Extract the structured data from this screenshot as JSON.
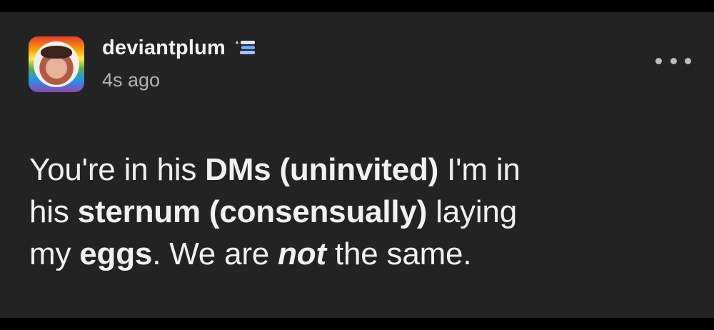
{
  "post": {
    "username": "deviantplum",
    "timestamp": "4s ago",
    "lines": [
      {
        "seg1": "You're in his ",
        "bold1": "DMs (uninvited)",
        "seg2": " I'm in"
      },
      {
        "seg1": "his ",
        "bold1": "sternum (consensually)",
        "seg2": " laying"
      },
      {
        "seg1": "my ",
        "bold1": "eggs",
        "seg2": ". We are ",
        "italic1": "not",
        "seg3": " the same."
      }
    ]
  },
  "icons": {
    "avatar": "avatar-image",
    "badge": "verified-stack-badge-icon",
    "more": "more-options-icon"
  },
  "colors": {
    "background": "#000000",
    "card": "#232323",
    "text": "#f1f1f1",
    "muted": "#b3b3b3",
    "badge": "#6ea8ff"
  }
}
